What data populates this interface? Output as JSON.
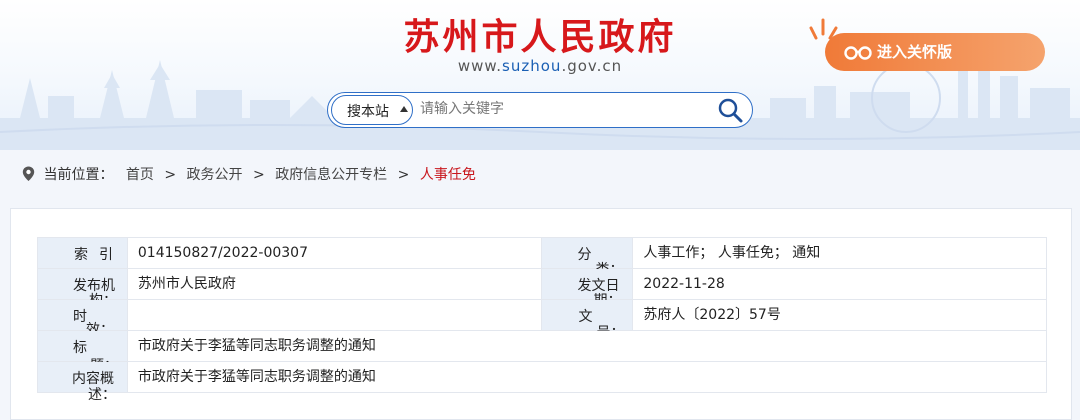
{
  "header": {
    "site_title": "苏州市人民政府",
    "url_prefix": "www.",
    "url_highlight": "suzhou",
    "url_suffix": ".gov.cn",
    "care_mode_label": "进入关怀版"
  },
  "search": {
    "scope_label": "搜本站",
    "placeholder": "请输入关键字"
  },
  "breadcrumb": {
    "prefix": "当前位置：",
    "items": [
      "首页",
      "政务公开",
      "政府信息公开专栏",
      "人事任免"
    ],
    "separator": ">"
  },
  "info": {
    "index": {
      "k1": "索",
      "k2": "引",
      "value": "014150827/2022-00307"
    },
    "category": {
      "k1": "分",
      "k2": "类：",
      "value": "人事工作；  人事任免；  通知"
    },
    "publisher": {
      "k1": "发布机",
      "k2": "构：",
      "value": "苏州市人民政府"
    },
    "issue_date": {
      "k1": "发文日",
      "k2": "期：",
      "value": "2022-11-28"
    },
    "time": {
      "k1": "时",
      "k2": "效：",
      "value": ""
    },
    "doc_no": {
      "k1": "文",
      "k2": "号：",
      "value": "苏府人〔2022〕57号"
    },
    "title": {
      "k1": "标",
      "k2": "题：",
      "value": "市政府关于李猛等同志职务调整的通知"
    },
    "summary": {
      "k1": "内容概",
      "k2": "述：",
      "value": "市政府关于李猛等同志职务调整的通知"
    }
  },
  "colors": {
    "title_red": "#d7181b",
    "accent_blue": "#2f6fc7",
    "care_orange": "#f07a38",
    "breadcrumb_current": "#c8161d",
    "label_cell_bg": "#e8eff8"
  },
  "icons": {
    "care": "glasses-icon",
    "search": "magnifier-icon",
    "location": "map-pin-icon",
    "scope_toggle": "caret-up-icon"
  }
}
